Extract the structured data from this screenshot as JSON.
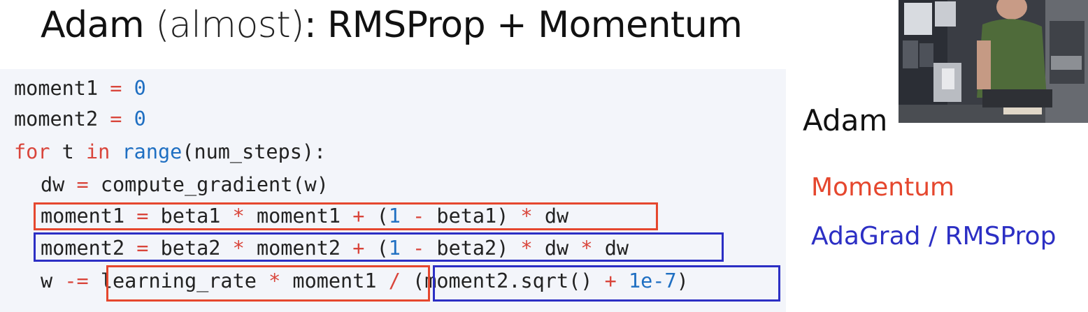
{
  "title": {
    "main_start": "Adam",
    "paren": "(almost)",
    "main_end": ": RMSProp + Momentum"
  },
  "code": {
    "line1": {
      "a": "moment1",
      "op": "=",
      "n": "0"
    },
    "line2": {
      "a": "moment2",
      "op": "=",
      "n": "0"
    },
    "line3": {
      "kw_for": "for",
      "var": "t",
      "kw_in": "in",
      "builtin": "range",
      "rest": "(num_steps):"
    },
    "line4": {
      "a": "dw",
      "op": "=",
      "rest": "compute_gradient(w)"
    },
    "line5": {
      "a": "moment1",
      "op1": "=",
      "b": "beta1",
      "op2": "*",
      "c": "moment1",
      "op3": "+",
      "p1": "(",
      "n": "1",
      "op4": "-",
      "d": "beta1)",
      "op5": "*",
      "e": "dw"
    },
    "line6": {
      "a": "moment2",
      "op1": "=",
      "b": "beta2",
      "op2": "*",
      "c": "moment2",
      "op3": "+",
      "p1": "(",
      "n": "1",
      "op4": "-",
      "d": "beta2)",
      "op5": "*",
      "e": "dw",
      "op6": "*",
      "f": "dw"
    },
    "line7": {
      "a": "w",
      "op1": "-=",
      "b": "learning_rate",
      "op2": "*",
      "c": "moment1",
      "op3": "/",
      "d": "(moment2.sqrt()",
      "op4": "+",
      "n": "1e-7",
      "e": ")"
    }
  },
  "side": {
    "adam_label": "Adam",
    "legend_momentum": "Momentum",
    "legend_adagrad": "AdaGrad / RMSProp"
  },
  "colors": {
    "momentum": "#e5472e",
    "adagrad": "#2c2fc4",
    "operator": "#d9453b",
    "number": "#1f6fc2"
  }
}
